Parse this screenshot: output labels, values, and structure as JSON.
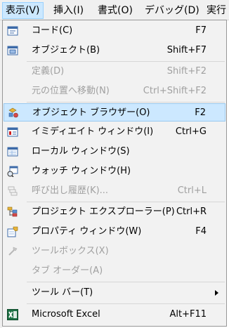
{
  "menubar": {
    "items": [
      {
        "label": "表示(V)"
      },
      {
        "label": "挿入(I)"
      },
      {
        "label": "書式(O)"
      },
      {
        "label": "デバッグ(D)"
      },
      {
        "label": "実行"
      }
    ]
  },
  "menu": {
    "items": [
      {
        "label": "コード(C)",
        "shortcut": "F7",
        "icon": "code-window-icon",
        "enabled": true
      },
      {
        "label": "オブジェクト(B)",
        "shortcut": "Shift+F7",
        "icon": "object-window-icon",
        "enabled": true
      },
      {
        "label": "定義(D)",
        "shortcut": "Shift+F2",
        "enabled": false
      },
      {
        "label": "元の位置へ移動(N)",
        "shortcut": "Ctrl+Shift+F2",
        "enabled": false
      },
      {
        "label": "オブジェクト ブラウザー(O)",
        "shortcut": "F2",
        "icon": "object-browser-icon",
        "enabled": true,
        "highlighted": true
      },
      {
        "label": "イミディエイト ウィンドウ(I)",
        "shortcut": "Ctrl+G",
        "icon": "immediate-window-icon",
        "enabled": true
      },
      {
        "label": "ローカル ウィンドウ(S)",
        "shortcut": "",
        "icon": "locals-window-icon",
        "enabled": true
      },
      {
        "label": "ウォッチ ウィンドウ(H)",
        "shortcut": "",
        "icon": "watch-window-icon",
        "enabled": true
      },
      {
        "label": "呼び出し履歴(K)...",
        "shortcut": "Ctrl+L",
        "icon": "call-stack-icon",
        "enabled": false
      },
      {
        "label": "プロジェクト エクスプローラー(P)",
        "shortcut": "Ctrl+R",
        "icon": "project-explorer-icon",
        "enabled": true
      },
      {
        "label": "プロパティ ウィンドウ(W)",
        "shortcut": "F4",
        "icon": "properties-window-icon",
        "enabled": true
      },
      {
        "label": "ツールボックス(X)",
        "shortcut": "",
        "icon": "toolbox-icon",
        "enabled": false
      },
      {
        "label": "タブ オーダー(A)",
        "shortcut": "",
        "enabled": false
      },
      {
        "label": "ツール バー(T)",
        "shortcut": "",
        "enabled": true,
        "submenu": true
      },
      {
        "label": "Microsoft Excel",
        "shortcut": "Alt+F11",
        "icon": "excel-icon",
        "enabled": true
      }
    ]
  },
  "colors": {
    "highlight_bg": "#cce8ff",
    "highlight_border": "#99c9ef",
    "disabled_text": "#a0a0a0",
    "menu_bg": "#f2f2f2",
    "excel_green": "#1e7145"
  }
}
